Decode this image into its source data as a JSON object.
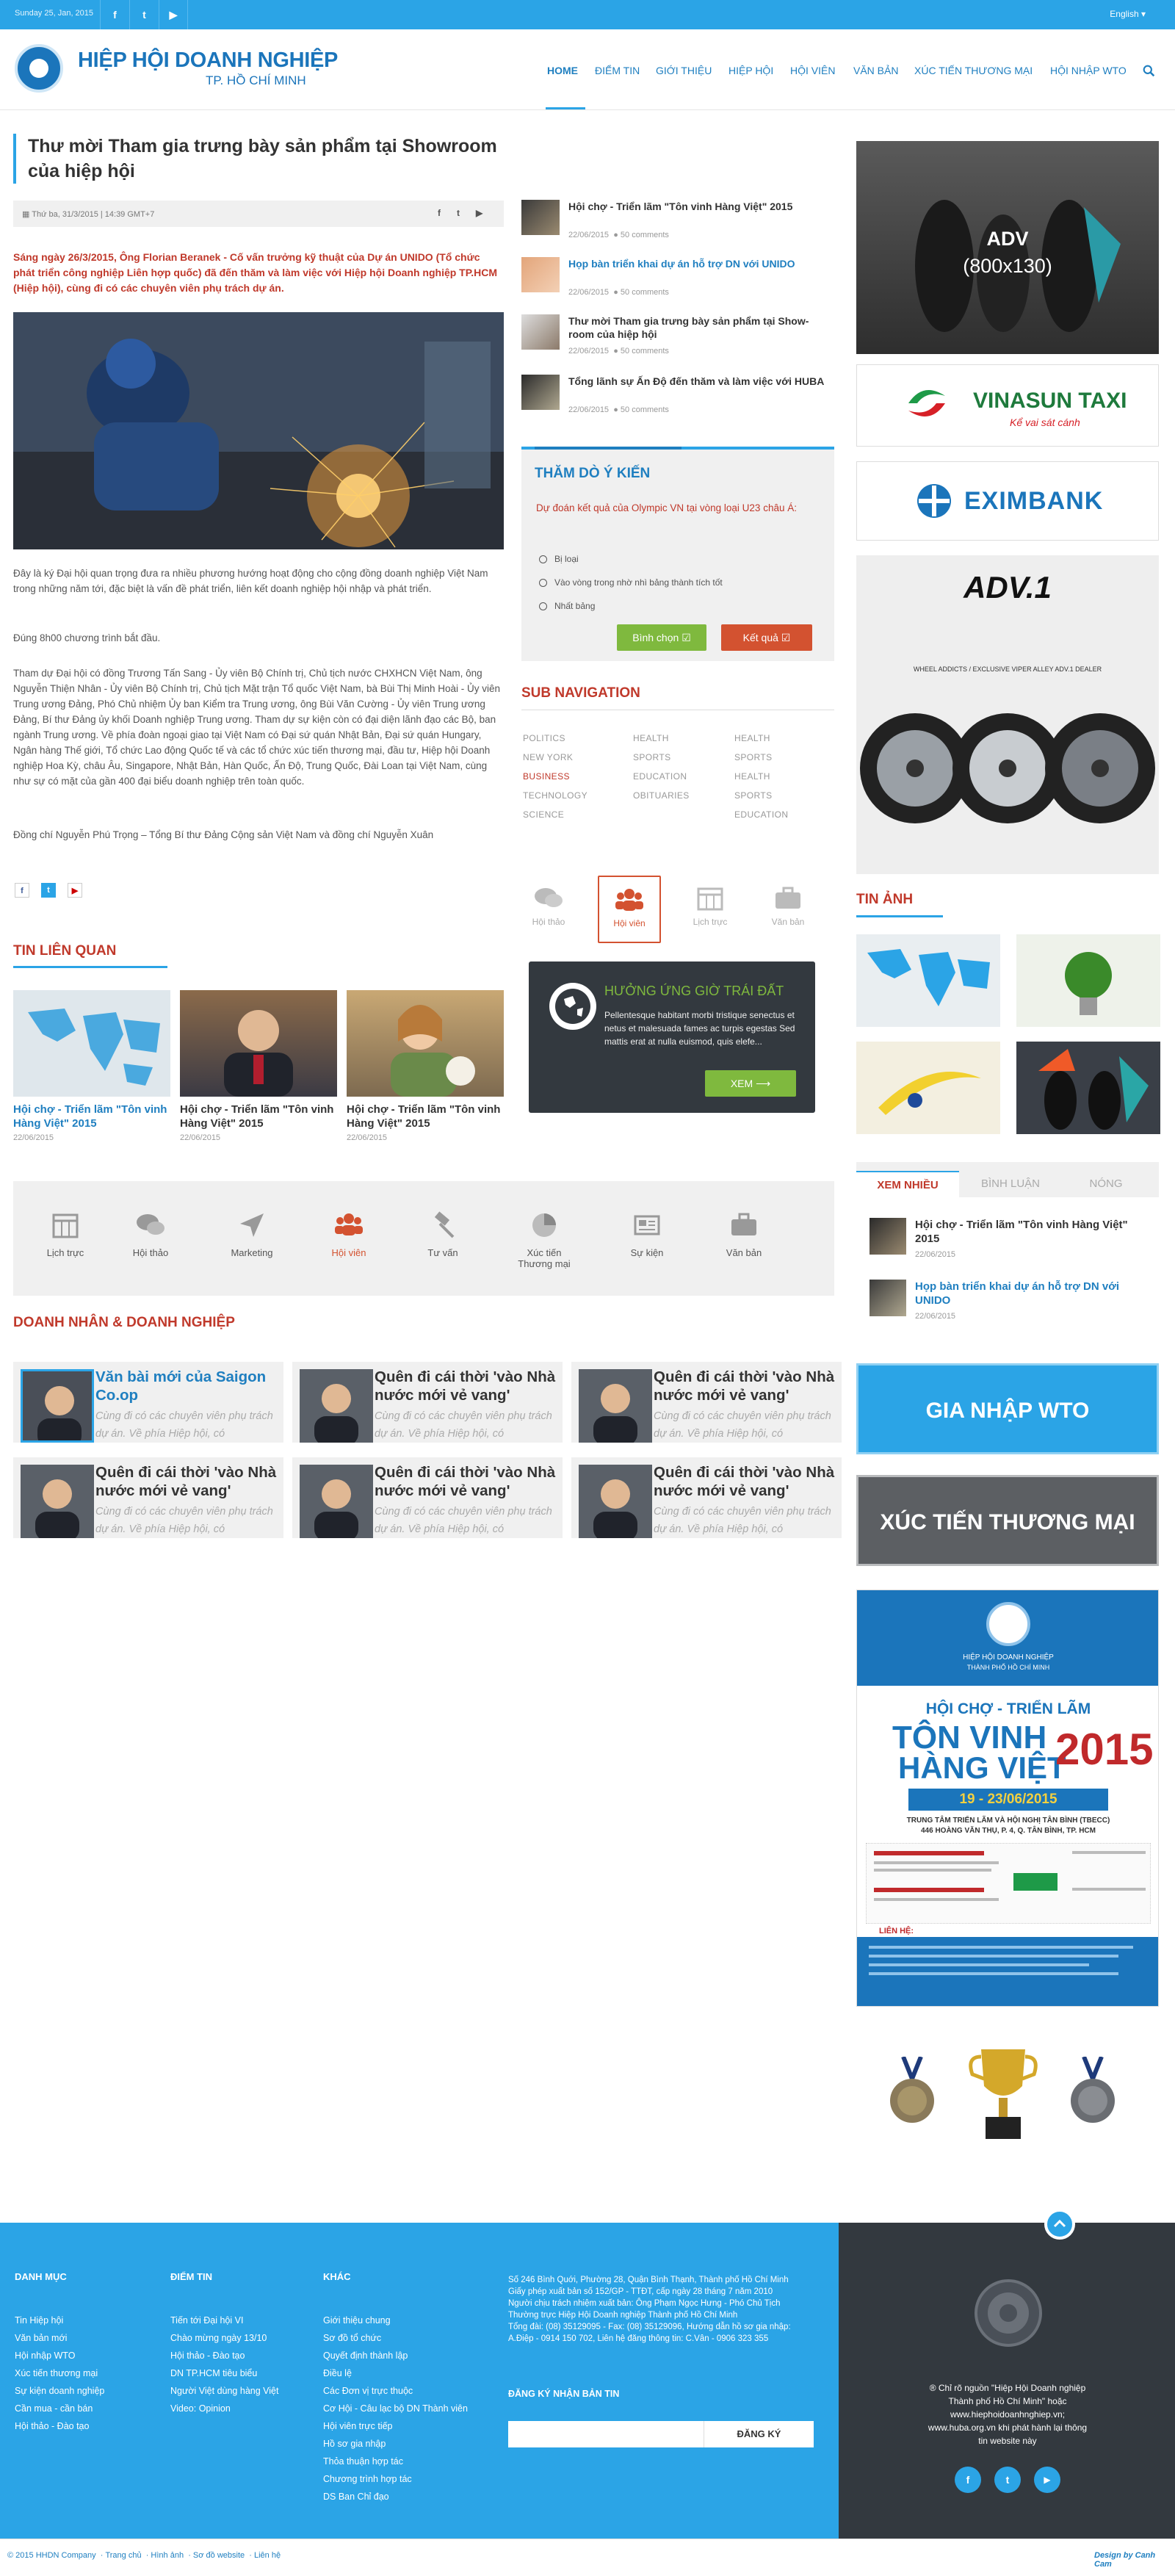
{
  "topbar": {
    "date": "Sunday 25, Jan, 2015",
    "language": "English"
  },
  "header": {
    "logo_title": "HIỆP HỘI DOANH NGHIỆP",
    "logo_sub": "TP. HỒ CHÍ MINH",
    "nav": [
      "HOME",
      "ĐIỂM TIN",
      "GIỚI THIỆU",
      "HIỆP HỘI",
      "HỘI VIÊN",
      "VĂN BẢN",
      "XÚC TIẾN THƯƠNG MẠI",
      "HỘI NHẬP WTO"
    ]
  },
  "article": {
    "title": "Thư mời Tham gia trưng bày sản phẩm tại Showroom của hiệp hội",
    "meta": "Thứ ba, 31/3/2015 | 14:39 GMT+7",
    "lead": "Sáng ngày 26/3/2015, Ông Florian Beranek - Cố vấn trưởng kỹ thuật của Dự án UNIDO (Tổ chức phát triển công nghiệp Liên hợp quốc) đã đến thăm và làm việc với Hiệp hội Doanh nghiệp TP.HCM (Hiệp hội), cùng đi có các chuyên viên phụ trách dự án.",
    "paragraphs": [
      "Đây là ký Đại hội quan trọng đưa ra nhiều phương hướng hoạt động cho cộng đồng doanh nghiệp Việt Nam trong những năm tới, đặc biệt là vấn đề phát triển, liên kết doanh nghiệp hội nhập và phát triển.",
      "Đúng 8h00 chương trình bắt đầu.",
      "Tham dự Đại hội có đồng Trương Tấn Sang - Ủy viên Bộ Chính trị, Chủ tịch nước CHXHCN Việt Nam, ông Nguyễn Thiện Nhân - Ủy viên Bộ Chính trị, Chủ tịch Mặt trận Tổ quốc Việt Nam, bà Bùi Thị Minh Hoài - Ủy viên Trung ương Đảng, Phó Chủ nhiệm Ủy ban Kiểm tra Trung ương, ông Bùi Văn Cường - Ủy viên Trung ương Đảng, Bí thư Đảng ủy khối Doanh nghiệp Trung ương. Tham dự sự kiện còn có đại diện lãnh đạo các Bộ, ban ngành Trung ương. Về phía đoàn ngoại giao tại Việt Nam có Đại sứ quán Nhật Bản, Đại sứ quán Hungary, Ngân hàng Thế giới, Tổ chức Lao động Quốc tế và các tổ chức xúc tiến thương mại, đầu tư, Hiệp hội Doanh nghiệp Hoa Kỳ, châu Âu, Singapore, Nhật Bản, Hàn Quốc, Ấn Độ, Trung Quốc, Đài Loan tại Việt Nam, cùng như sự có mặt của gần 400 đại biểu doanh nghiệp trên toàn quốc.",
      "Đồng chí Nguyễn Phú Trọng – Tổng Bí thư Đảng Cộng sản Việt Nam và  đồng chí Nguyễn Xuân"
    ]
  },
  "side_news": [
    {
      "title": "Hội chợ - Triển lãm \"Tôn vinh Hàng Việt\" 2015",
      "date": "22/06/2015",
      "comments": "50 comments"
    },
    {
      "title": "Họp bàn triển khai dự án hỗ trợ DN với UNIDO",
      "date": "22/06/2015",
      "comments": "50 comments"
    },
    {
      "title": "Thư mời Tham gia trưng bày sản phẩm tại Show-room của hiệp hội",
      "date": "22/06/2015",
      "comments": "50 comments"
    },
    {
      "title": "Tổng lãnh sự Ấn Độ đến thăm và làm việc với HUBA",
      "date": "22/06/2015",
      "comments": "50 comments"
    }
  ],
  "poll": {
    "title": "THĂM DÒ Ý KIẾN",
    "question": "Dự đoán kết quả của Olympic VN tại vòng loại U23 châu Á:",
    "options": [
      "Bị loại",
      "Vào vòng trong nhờ nhì bảng thành tích tốt",
      "Nhất bảng"
    ],
    "vote_label": "Bình chọn",
    "result_label": "Kết quả"
  },
  "subnav": {
    "title": "SUB NAVIGATION",
    "col1": [
      "POLITICS",
      "NEW YORK",
      "BUSINESS",
      "TECHNOLOGY",
      "SCIENCE"
    ],
    "col2": [
      "HEALTH",
      "SPORTS",
      "EDUCATION",
      "OBITUARIES"
    ],
    "col3": [
      "HEALTH",
      "SPORTS",
      "HEALTH",
      "SPORTS",
      "EDUCATION"
    ]
  },
  "service_tabs": [
    "Hội thảo",
    "Hội viên",
    "Lịch trực",
    "Văn bản"
  ],
  "related": {
    "title": "TIN LIÊN QUAN",
    "items": [
      {
        "title": "Hội chợ - Triển lãm \"Tôn vinh Hàng Việt\" 2015",
        "date": "22/06/2015"
      },
      {
        "title": "Hội chợ - Triển lãm \"Tôn vinh Hàng Việt\" 2015",
        "date": "22/06/2015"
      },
      {
        "title": "Hội chợ - Triển lãm \"Tôn vinh Hàng Việt\" 2015",
        "date": "22/06/2015"
      }
    ]
  },
  "promo": {
    "title": "HƯỞNG ỨNG GIỜ TRÁI ĐẤT",
    "text": "Pellentesque habitant morbi tristique senectus et netus et malesuada fames ac turpis egestas Sed mattis erat at nulla euismod, quis elefe...",
    "button": "XEM"
  },
  "services": [
    "Lịch trực",
    "Hội thảo",
    "Marketing",
    "Hội viên",
    "Tư vấn",
    "Xúc tiến Thương mại",
    "Sự kiện",
    "Văn bản"
  ],
  "biz": {
    "title": "DOANH NHÂN & DOANH NGHIỆP",
    "cards": [
      {
        "title": "Văn bài mới của Saigon Co.op",
        "excerpt": "Cùng đi có các chuyên viên phụ trách dự án. Về phía Hiệp hội, có"
      },
      {
        "title": "Quên đi cái thời 'vào Nhà nước mới vẻ vang'",
        "excerpt": "Cùng đi có các chuyên viên phụ trách dự án. Về phía Hiệp hội, có"
      },
      {
        "title": "Quên đi cái thời 'vào Nhà nước mới vẻ vang'",
        "excerpt": "Cùng đi có các chuyên viên phụ trách dự án. Về phía Hiệp hội, có"
      },
      {
        "title": "Quên đi cái thời 'vào Nhà nước mới vẻ vang'",
        "excerpt": "Cùng đi có các chuyên viên phụ trách dự án. Về phía Hiệp hội, có"
      },
      {
        "title": "Quên đi cái thời 'vào Nhà nước mới vẻ vang'",
        "excerpt": "Cùng đi có các chuyên viên phụ trách dự án. Về phía Hiệp hội, có"
      },
      {
        "title": "Quên đi cái thời 'vào Nhà nước mới vẻ vang'",
        "excerpt": "Cùng đi có các chuyên viên phụ trách dự án. Về phía Hiệp hội, có"
      }
    ]
  },
  "sidebar": {
    "adv_label": "ADV",
    "adv_size": "(800x130)",
    "vinasun_name": "VINASUN TAXI",
    "vinasun_slogan": "Kể vai sát cánh",
    "eximbank_name": "EXIMBANK",
    "adv1_title": "ADV.1",
    "adv1_caption": "WHEEL ADDICTS / EXCLUSIVE VIPER ALLEY ADV.1 DEALER",
    "gallery_title": "TIN ẢNH",
    "tabs": [
      "XEM NHIỀU",
      "BÌNH LUẬN",
      "NÓNG"
    ],
    "tab_items": [
      {
        "title": "Hội chợ - Triển lãm \"Tôn vinh Hàng Việt\" 2015",
        "date": "22/06/2015"
      },
      {
        "title": "Họp bàn triển khai dự án hỗ trợ DN với UNIDO",
        "date": "22/06/2015"
      }
    ],
    "wto_button": "GIA NHẬP WTO",
    "trade_button": "XÚC TIẾN THƯƠNG MẠI",
    "banner": {
      "org": "HIỆP HỘI DOANH NGHIỆP",
      "org_city": "THÀNH PHỐ HỒ CHÍ MINH",
      "kicker": "HỘI CHỢ - TRIỂN LÃM",
      "line1": "TÔN VINH",
      "line2": "HÀNG VIỆT",
      "year": "2015",
      "dates": "19 - 23/06/2015",
      "venue": "TRUNG TÂM TRIỂN LÃM VÀ HỘI NGHỊ TÂN BÌNH (TBECC)",
      "address": "446 HOÀNG VĂN THỤ, P. 4, Q. TÂN BÌNH, TP. HCM",
      "contact": "LIÊN HỆ:"
    }
  },
  "footer": {
    "col1_title": "DANH MỤC",
    "col1": [
      "Tin Hiệp hội",
      "Văn bản mới",
      "Hội nhập WTO",
      "Xúc tiến thương mại",
      "Sự kiện doanh nghiệp",
      "Cần mua - cần bán",
      "Hội thảo - Đào tạo"
    ],
    "col2_title": "ĐIỂM TIN",
    "col2": [
      "Tiến tới Đại hội VI",
      "Chào mừng ngày 13/10",
      "Hội thảo - Đào tạo",
      "DN TP.HCM tiêu biểu",
      "Người Việt dùng hàng Việt",
      "Video: Opinion"
    ],
    "col3_title": "KHÁC",
    "col3": [
      "Giới thiệu chung",
      "Sơ đồ tổ chức",
      "Quyết định thành lập",
      "Điều lệ",
      "Các Đơn vị trực thuộc",
      "Cơ Hội - Câu lạc bộ DN Thành viên",
      "Hội viên trực tiếp",
      "Hồ sơ gia nhập",
      "Thỏa thuận hợp tác",
      "Chương trình hợp tác",
      "DS Ban Chỉ đạo"
    ],
    "info": [
      "Số 246 Bình Quới, Phường 28, Quận Bình Thạnh, Thành phố Hồ Chí Minh",
      "Giấy phép xuất bản số 152/GP - TTĐT, cấp ngày 28 tháng 7 năm 2010",
      "Người chịu trách nhiệm xuất bản: Ông Phạm Ngọc Hưng - Phó Chủ Tịch",
      "Thường trực Hiệp Hội Doanh nghiệp Thành phố Hồ Chí Minh",
      "Tổng đài: (08) 35129095 - Fax: (08) 35129096, Hướng dẫn hồ sơ gia nhập:",
      "A.Điệp - 0914 150 702, Liên hệ đăng thông tin: C.Vân - 0906 323 355"
    ],
    "newsletter_title": "ĐĂNG KÝ NHẬN BẢN TIN",
    "newsletter_placeholder": "",
    "newsletter_button": "ĐĂNG KÝ",
    "copyright_note": "® Chỉ rõ nguồn \"Hiệp Hội Doanh nghiệp Thành phố Hồ Chí Minh\" hoặc www.hiephoidoanhnghiep.vn; www.huba.org.vn khi phát hành lại thông tin website này",
    "bottom_links": [
      "© 2015 HHDN Company",
      "Trang chủ",
      "Hình ảnh",
      "Sơ đồ website",
      "Liên hệ"
    ],
    "design": "Design by Canh Cam"
  },
  "colors": {
    "accent": "#2ba4e6",
    "title_red": "#c0392b",
    "dark": "#33393f",
    "green": "#7fb93e",
    "orange": "#d35230"
  }
}
